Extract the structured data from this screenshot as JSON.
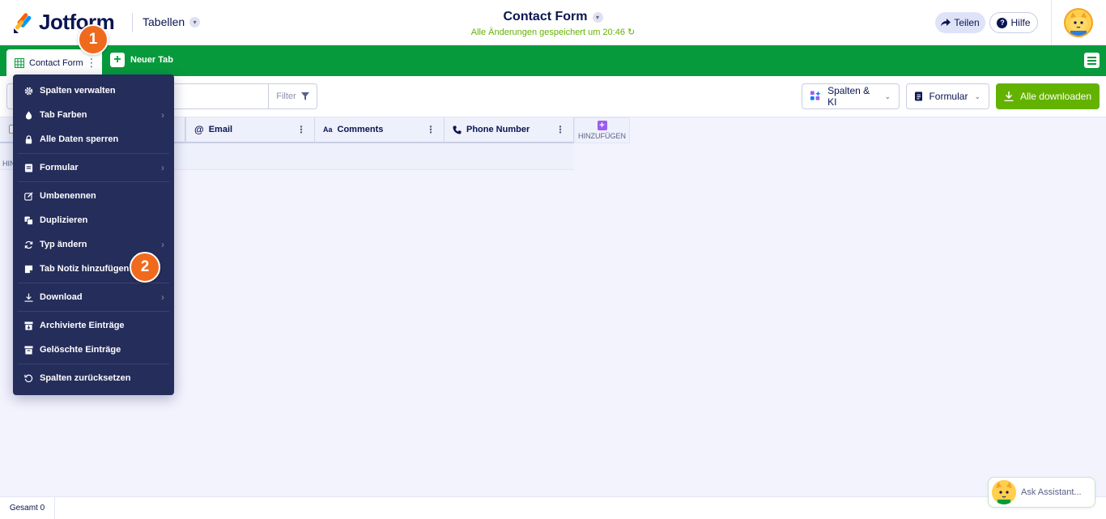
{
  "header": {
    "brand": "Jotform",
    "tables_label": "Tabellen",
    "title": "Contact Form",
    "saved_status": "Alle Änderungen gespeichert um 20:46",
    "share_label": "Teilen",
    "help_label": "Hilfe"
  },
  "tabs": {
    "active_label": "Contact Form",
    "new_tab_label": "Neuer Tab"
  },
  "toolbar": {
    "filter_label": "Filter",
    "columns_ai_label": "Spalten & KI",
    "form_label": "Formular",
    "download_all_label": "Alle downloaden"
  },
  "grid": {
    "columns": [
      {
        "label": "Email",
        "icon": "at-icon"
      },
      {
        "label": "Comments",
        "icon": "text-icon"
      },
      {
        "label": "Phone Number",
        "icon": "phone-icon"
      }
    ],
    "add_column_label": "HINZUFÜGEN",
    "add_row_label": "HIN"
  },
  "dropdown": {
    "items": [
      {
        "label": "Spalten verwalten",
        "icon": "gear-icon"
      },
      {
        "label": "Tab Farben",
        "icon": "droplet-icon"
      },
      {
        "label": "Alle Daten sperren",
        "icon": "lock-icon"
      },
      {
        "label": "Formular",
        "icon": "form-icon"
      },
      {
        "label": "Umbenennen",
        "icon": "edit-icon"
      },
      {
        "label": "Duplizieren",
        "icon": "duplicate-icon"
      },
      {
        "label": "Typ ändern",
        "icon": "refresh-icon"
      },
      {
        "label": "Tab Notiz hinzufügen",
        "icon": "note-icon"
      },
      {
        "label": "Download",
        "icon": "download-icon"
      },
      {
        "label": "Archivierte Einträge",
        "icon": "archive-icon"
      },
      {
        "label": "Gelöschte Einträge",
        "icon": "trash-icon"
      },
      {
        "label": "Spalten zurücksetzen",
        "icon": "reset-icon"
      }
    ]
  },
  "badges": [
    "1",
    "2"
  ],
  "footer": {
    "total_label": "Gesamt 0",
    "assistant_label": "Ask Assistant..."
  },
  "colors": {
    "tabbar": "#079a3c",
    "download_button": "#64b200",
    "dropdown_bg": "#252d5b",
    "badge": "#f06a1d"
  }
}
